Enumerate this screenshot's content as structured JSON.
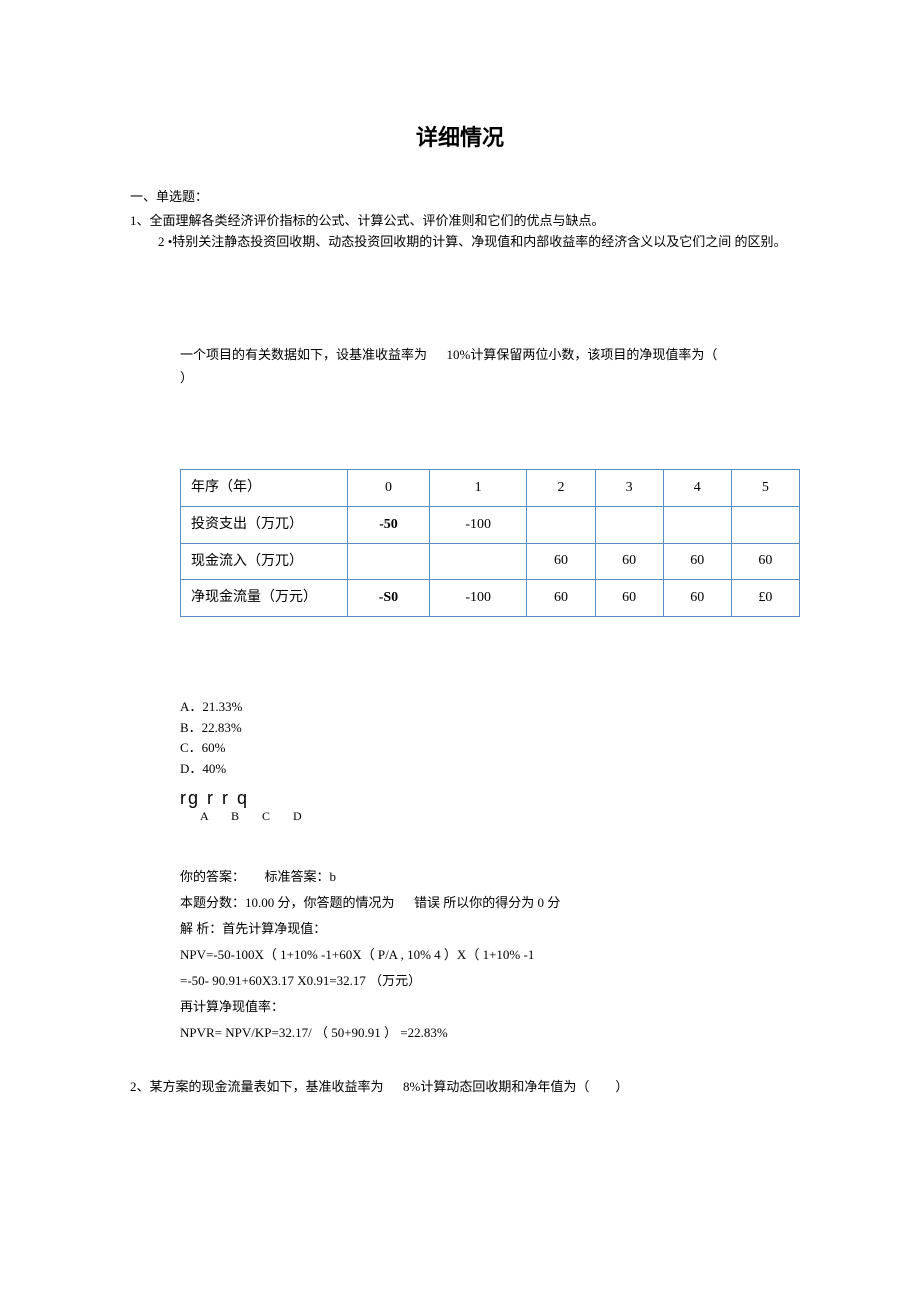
{
  "title": "详细情况",
  "section_heading": "一、单选题：",
  "point1": "1、全面理解各类经济评价指标的公式、计算公式、评价准则和它们的优点与缺点。",
  "point2": "2 •特别关注静态投资回收期、动态投资回收期的计算、净现值和内部收益率的经济含义以及它们之间 的区别。",
  "q1": {
    "prompt_before": "一个项目的有关数据如下，设基准收益率为",
    "prompt_rate": "10%计算保留两位小数，该项目的净现值率为（",
    "prompt_close": "）",
    "table": {
      "rows": [
        {
          "label": "年序（年）",
          "cells": [
            "0",
            "1",
            "2",
            "3",
            "4",
            "5"
          ]
        },
        {
          "label": "投资支出（万兀）",
          "cells": [
            "-50",
            "-100",
            "",
            "",
            "",
            ""
          ],
          "bold0": true
        },
        {
          "label": "现金流入（万兀）",
          "cells": [
            "",
            "",
            "60",
            "60",
            "60",
            "60"
          ]
        },
        {
          "label": "净现金流量（万元）",
          "cells": [
            "-S0",
            "-100",
            "60",
            "60",
            "60",
            "£0"
          ],
          "bold0": true
        }
      ]
    },
    "options": {
      "A": "A．21.33%",
      "B": "B．22.83%",
      "C": "C．60%",
      "D": "D．40%"
    },
    "radio_glyphs": "rg r r q",
    "radio_labels": "A B C D",
    "your_answer_label": "你的答案：",
    "std_answer_label": "标准答案：b",
    "score_line_a": "本题分数：10.00 分，你答题的情况为",
    "score_line_b": "错误 所以你的得分为 0 分",
    "analysis_label": "解 析：首先计算净现值：",
    "calc1": "NPV=-50-100X（ 1+10% -1+60X（ P/A , 10% 4 ）X（ 1+10% -1",
    "calc2": "=-50- 90.91+60X3.17 X0.91=32.17 （万元）",
    "calc3": "再计算净现值率：",
    "calc4": "NPVR= NPV/KP=32.17/ （ 50+90.91 ）  =22.83%"
  },
  "q2": {
    "prompt_before": "2、某方案的现金流量表如下，基准收益率为",
    "prompt_rate": "8%计算动态回收期和净年值为（",
    "prompt_close": "）"
  }
}
